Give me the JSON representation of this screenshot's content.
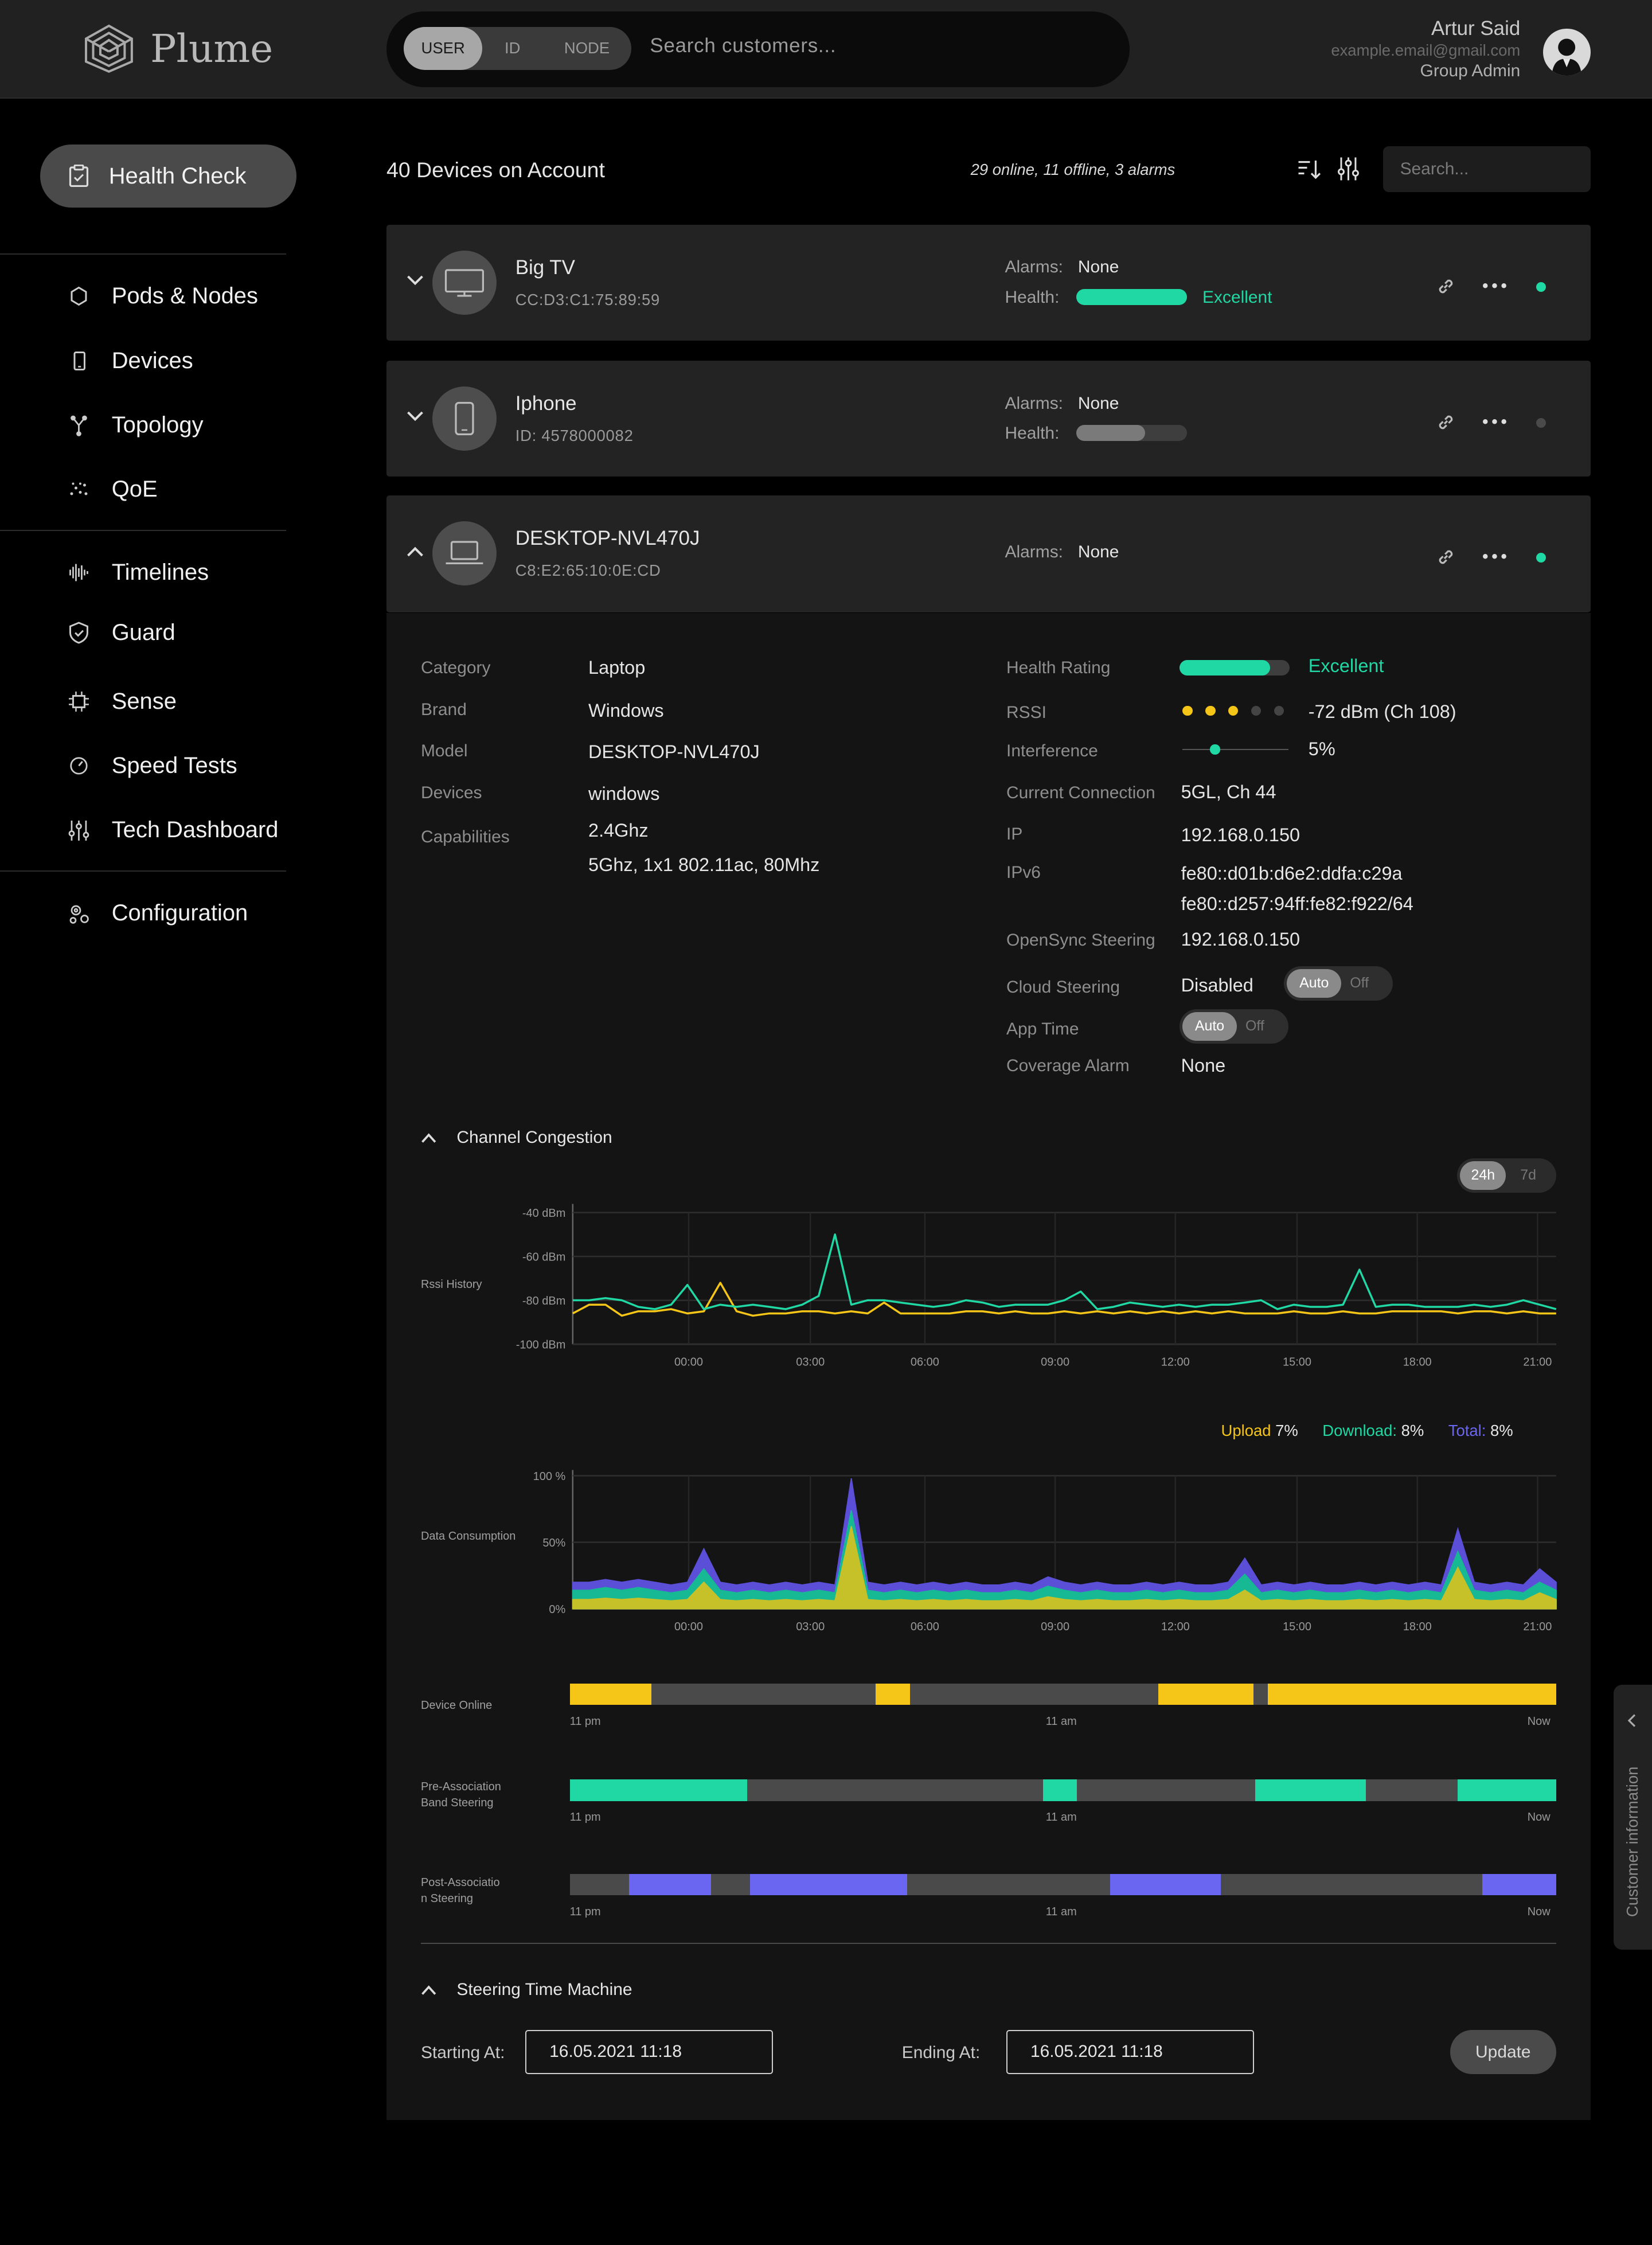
{
  "brand": {
    "name": "Plume"
  },
  "search": {
    "modes": [
      "USER",
      "ID",
      "NODE"
    ],
    "active_mode": "USER",
    "placeholder": "Search customers..."
  },
  "user": {
    "name": "Artur Said",
    "email": "example.email@gmail.com",
    "role": "Group Admin"
  },
  "sidebar": {
    "primary": {
      "label": "Health Check",
      "icon": "clipboard-icon"
    },
    "groups": [
      [
        {
          "label": "Pods & Nodes",
          "icon": "hexagon-icon"
        },
        {
          "label": "Devices",
          "icon": "phone-icon"
        },
        {
          "label": "Topology",
          "icon": "topology-icon"
        },
        {
          "label": "QoE",
          "icon": "qoe-icon"
        }
      ],
      [
        {
          "label": "Timelines",
          "icon": "waveform-icon"
        },
        {
          "label": "Guard",
          "icon": "shield-icon"
        },
        {
          "label": "Sense",
          "icon": "chip-icon"
        },
        {
          "label": "Speed Tests",
          "icon": "gauge-icon"
        },
        {
          "label": "Tech Dashboard",
          "icon": "sliders-icon"
        }
      ],
      [
        {
          "label": "Configuration",
          "icon": "gears-icon"
        }
      ]
    ]
  },
  "main": {
    "device_count": "40 Devices on Account",
    "device_status": "29 online, 11 offline, 3 alarms",
    "search_placeholder": "Search..."
  },
  "devices": [
    {
      "name": "Big TV",
      "sub": "CC:D3:C1:75:89:59",
      "alarms_label": "Alarms:",
      "alarms": "None",
      "health_label": "Health:",
      "health": "Excellent",
      "health_fill": 1.0,
      "online": true,
      "icon": "tv-icon"
    },
    {
      "name": "Iphone",
      "sub": "ID: 4578000082",
      "alarms_label": "Alarms:",
      "alarms": "None",
      "health_label": "Health:",
      "health": "",
      "health_fill": 0.62,
      "online": false,
      "icon": "phone-icon"
    },
    {
      "name": "DESKTOP-NVL470J",
      "sub": "C8:E2:65:10:0E:CD",
      "alarms_label": "Alarms:",
      "alarms": "None",
      "online": true,
      "icon": "laptop-icon"
    }
  ],
  "details": {
    "left": [
      {
        "label": "Category",
        "value": "Laptop"
      },
      {
        "label": "Brand",
        "value": "Windows"
      },
      {
        "label": "Model",
        "value": "DESKTOP-NVL470J"
      },
      {
        "label": "Devices",
        "value": "windows"
      },
      {
        "label": "Capabilities",
        "value": "2.4Ghz",
        "value2": "5Ghz, 1x1 802.11ac, 80Mhz"
      }
    ],
    "right": {
      "health_rating_label": "Health Rating",
      "health_rating": "Excellent",
      "health_fill": 0.82,
      "rssi_label": "RSSI",
      "rssi": "-72 dBm (Ch 108)",
      "rssi_dots_on": 3,
      "rssi_dots_total": 5,
      "interference_label": "Interference",
      "interference": "5%",
      "interference_level": 0.3,
      "current_connection_label": "Current Connection",
      "current_connection": "5GL, Ch 44",
      "ip_label": "IP",
      "ip": "192.168.0.150",
      "ipv6_label": "IPv6",
      "ipv6_1": "fe80::d01b:d6e2:ddfa:c29a",
      "ipv6_2": "fe80::d257:94ff:fe82:f922/64",
      "opensync_label": "OpenSync Steering",
      "opensync": "192.168.0.150",
      "cloud_steering_label": "Cloud Steering",
      "cloud_steering": "Disabled",
      "app_time_label": "App Time",
      "coverage_alarm_label": "Coverage Alarm",
      "coverage_alarm": "None",
      "toggle_on": "Auto",
      "toggle_off": "Off"
    }
  },
  "channel_congestion": {
    "title": "Channel Congestion",
    "ranges": [
      "24h",
      "7d"
    ],
    "active_range": "24h",
    "rssi_label": "Rssi History",
    "data_label": "Data Consumption",
    "legend": [
      {
        "name": "Upload",
        "value": "7%",
        "color": "#f5c518"
      },
      {
        "name": "Download:",
        "value": "8%",
        "color": "#1fd8a4"
      },
      {
        "name": "Total:",
        "value": "8%",
        "color": "#6a66f2"
      }
    ]
  },
  "chart_data": [
    {
      "type": "line",
      "ylabel": "Rssi History",
      "yticks": [
        "-40 dBm",
        "-60 dBm",
        "-80 dBm",
        "-100 dBm"
      ],
      "ylim": [
        -100,
        -40
      ],
      "xticks": [
        "00:00",
        "03:00",
        "06:00",
        "09:00",
        "12:00",
        "15:00",
        "18:00",
        "21:00"
      ],
      "series": [
        {
          "color": "#1fd8a4",
          "values": [
            -80,
            -80,
            -79,
            -80,
            -83,
            -84,
            -82,
            -73,
            -84,
            -82,
            -83,
            -82,
            -83,
            -84,
            -82,
            -78,
            -50,
            -82,
            -80,
            -80,
            -81,
            -82,
            -83,
            -82,
            -80,
            -81,
            -83,
            -82,
            -82,
            -82,
            -80,
            -76,
            -84,
            -83,
            -81,
            -82,
            -83,
            -82,
            -83,
            -82,
            -82,
            -81,
            -80,
            -84,
            -82,
            -83,
            -83,
            -82,
            -66,
            -83,
            -82,
            -82,
            -83,
            -83,
            -83,
            -82,
            -83,
            -82,
            -80,
            -82,
            -84
          ]
        },
        {
          "color": "#f5c518",
          "values": [
            -86,
            -82,
            -82,
            -87,
            -85,
            -85,
            -84,
            -86,
            -85,
            -72,
            -85,
            -87,
            -86,
            -86,
            -85,
            -85,
            -86,
            -85,
            -86,
            -81,
            -86,
            -86,
            -86,
            -86,
            -85,
            -85,
            -86,
            -85,
            -86,
            -86,
            -85,
            -86,
            -85,
            -86,
            -85,
            -86,
            -85,
            -86,
            -85,
            -86,
            -85,
            -86,
            -86,
            -86,
            -85,
            -86,
            -86,
            -85,
            -86,
            -86,
            -85,
            -85,
            -85,
            -85,
            -86,
            -85,
            -85,
            -86,
            -85,
            -86,
            -86
          ]
        }
      ]
    },
    {
      "type": "area",
      "ylabel": "Data Consumption",
      "yticks": [
        "100 %",
        "50%",
        "0%"
      ],
      "ylim": [
        0,
        100
      ],
      "xticks": [
        "00:00",
        "03:00",
        "06:00",
        "09:00",
        "12:00",
        "15:00",
        "18:00",
        "21:00"
      ],
      "series": [
        {
          "name": "Total",
          "color": "#5a4fd6",
          "values": [
            20,
            20,
            22,
            20,
            22,
            20,
            18,
            20,
            45,
            20,
            18,
            20,
            18,
            20,
            18,
            20,
            18,
            98,
            20,
            18,
            20,
            18,
            20,
            18,
            20,
            18,
            18,
            20,
            18,
            24,
            20,
            18,
            20,
            18,
            18,
            20,
            18,
            20,
            18,
            18,
            20,
            38,
            18,
            20,
            18,
            20,
            18,
            18,
            20,
            18,
            20,
            18,
            20,
            18,
            60,
            20,
            18,
            20,
            18,
            30,
            20
          ]
        },
        {
          "name": "Download",
          "color": "#17b894",
          "values": [
            14,
            14,
            16,
            14,
            16,
            14,
            12,
            14,
            30,
            14,
            12,
            14,
            12,
            14,
            12,
            14,
            12,
            74,
            14,
            12,
            14,
            12,
            14,
            12,
            14,
            12,
            12,
            14,
            12,
            17,
            14,
            12,
            14,
            12,
            12,
            14,
            12,
            14,
            12,
            12,
            14,
            26,
            12,
            14,
            12,
            14,
            12,
            12,
            14,
            12,
            14,
            12,
            14,
            12,
            43,
            14,
            12,
            14,
            12,
            20,
            14
          ]
        },
        {
          "name": "Upload",
          "color": "#c6c129",
          "values": [
            7,
            7,
            8,
            7,
            8,
            7,
            6,
            7,
            20,
            7,
            6,
            7,
            6,
            7,
            6,
            7,
            6,
            62,
            7,
            6,
            7,
            6,
            7,
            6,
            7,
            6,
            6,
            7,
            6,
            9,
            7,
            6,
            7,
            6,
            6,
            7,
            6,
            7,
            6,
            6,
            7,
            14,
            6,
            7,
            6,
            7,
            6,
            6,
            7,
            6,
            7,
            6,
            7,
            6,
            31,
            7,
            6,
            7,
            6,
            12,
            7
          ]
        }
      ]
    }
  ],
  "timelines": [
    {
      "label": "Device Online",
      "color": "#f5c518",
      "segments": [
        [
          0,
          0.083
        ],
        [
          0.31,
          0.345
        ],
        [
          0.597,
          0.693
        ],
        [
          0.708,
          1.0
        ]
      ],
      "ticks": [
        "11 pm",
        "11 am",
        "Now"
      ]
    },
    {
      "label": "Pre-Association Band Steering",
      "color": "#1fd8a4",
      "segments": [
        [
          0,
          0.18
        ],
        [
          0.48,
          0.514
        ],
        [
          0.695,
          0.807
        ],
        [
          0.9,
          1.0
        ]
      ],
      "ticks": [
        "11 pm",
        "11 am",
        "Now"
      ]
    },
    {
      "label": "Post-Association Steering",
      "color": "#6a66f2",
      "segments": [
        [
          0.06,
          0.143
        ],
        [
          0.183,
          0.342
        ],
        [
          0.548,
          0.66
        ],
        [
          0.925,
          1.0
        ]
      ],
      "ticks": [
        "11 pm",
        "11 am",
        "Now"
      ]
    }
  ],
  "time_machine": {
    "title": "Steering Time Machine",
    "start_label": "Starting At:",
    "start_value": "16.05.2021   11:18",
    "end_label": "Ending At:",
    "end_value": "16.05.2021   11:18",
    "update_label": "Update"
  },
  "customer_tab": {
    "label": "Customer information"
  },
  "colors": {
    "accent_green": "#1fd8a4",
    "accent_yellow": "#f5c518",
    "accent_purple": "#6a66f2"
  }
}
